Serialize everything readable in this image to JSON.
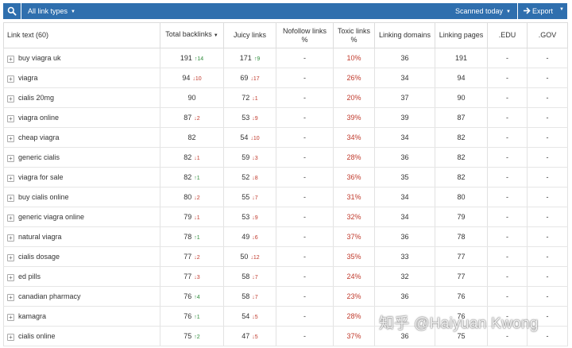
{
  "toolbar": {
    "search_icon": "search-icon",
    "link_types_label": "All link types",
    "scanned_label": "Scanned today",
    "export_label": "Export"
  },
  "columns": [
    "Link text (60)",
    "Total backlinks",
    "Juicy links",
    "Nofollow links %",
    "Toxic links %",
    "Linking domains",
    "Linking pages",
    ".EDU",
    ".GOV"
  ],
  "rows": [
    {
      "text": "buy viagra uk",
      "total": "191",
      "total_dir": "up",
      "total_delta": "14",
      "juicy": "171",
      "juicy_dir": "up",
      "juicy_delta": "9",
      "nofollow": "-",
      "toxic": "10%",
      "domains": "36",
      "pages": "191",
      "edu": "-",
      "gov": "-"
    },
    {
      "text": "viagra",
      "total": "94",
      "total_dir": "down",
      "total_delta": "10",
      "juicy": "69",
      "juicy_dir": "down",
      "juicy_delta": "17",
      "nofollow": "-",
      "toxic": "26%",
      "domains": "34",
      "pages": "94",
      "edu": "-",
      "gov": "-"
    },
    {
      "text": "cialis 20mg",
      "total": "90",
      "total_dir": "",
      "total_delta": "",
      "juicy": "72",
      "juicy_dir": "down",
      "juicy_delta": "1",
      "nofollow": "-",
      "toxic": "20%",
      "domains": "37",
      "pages": "90",
      "edu": "-",
      "gov": "-"
    },
    {
      "text": "viagra online",
      "total": "87",
      "total_dir": "down",
      "total_delta": "2",
      "juicy": "53",
      "juicy_dir": "down",
      "juicy_delta": "9",
      "nofollow": "-",
      "toxic": "39%",
      "domains": "39",
      "pages": "87",
      "edu": "-",
      "gov": "-"
    },
    {
      "text": "cheap viagra",
      "total": "82",
      "total_dir": "",
      "total_delta": "",
      "juicy": "54",
      "juicy_dir": "down",
      "juicy_delta": "10",
      "nofollow": "-",
      "toxic": "34%",
      "domains": "34",
      "pages": "82",
      "edu": "-",
      "gov": "-"
    },
    {
      "text": "generic cialis",
      "total": "82",
      "total_dir": "down",
      "total_delta": "1",
      "juicy": "59",
      "juicy_dir": "down",
      "juicy_delta": "3",
      "nofollow": "-",
      "toxic": "28%",
      "domains": "36",
      "pages": "82",
      "edu": "-",
      "gov": "-"
    },
    {
      "text": "viagra for sale",
      "total": "82",
      "total_dir": "up",
      "total_delta": "1",
      "juicy": "52",
      "juicy_dir": "down",
      "juicy_delta": "8",
      "nofollow": "-",
      "toxic": "36%",
      "domains": "35",
      "pages": "82",
      "edu": "-",
      "gov": "-"
    },
    {
      "text": "buy cialis online",
      "total": "80",
      "total_dir": "down",
      "total_delta": "2",
      "juicy": "55",
      "juicy_dir": "down",
      "juicy_delta": "7",
      "nofollow": "-",
      "toxic": "31%",
      "domains": "34",
      "pages": "80",
      "edu": "-",
      "gov": "-"
    },
    {
      "text": "generic viagra online",
      "total": "79",
      "total_dir": "down",
      "total_delta": "1",
      "juicy": "53",
      "juicy_dir": "down",
      "juicy_delta": "9",
      "nofollow": "-",
      "toxic": "32%",
      "domains": "34",
      "pages": "79",
      "edu": "-",
      "gov": "-"
    },
    {
      "text": "natural viagra",
      "total": "78",
      "total_dir": "up",
      "total_delta": "1",
      "juicy": "49",
      "juicy_dir": "down",
      "juicy_delta": "6",
      "nofollow": "-",
      "toxic": "37%",
      "domains": "36",
      "pages": "78",
      "edu": "-",
      "gov": "-"
    },
    {
      "text": "cialis dosage",
      "total": "77",
      "total_dir": "down",
      "total_delta": "2",
      "juicy": "50",
      "juicy_dir": "down",
      "juicy_delta": "12",
      "nofollow": "-",
      "toxic": "35%",
      "domains": "33",
      "pages": "77",
      "edu": "-",
      "gov": "-"
    },
    {
      "text": "ed pills",
      "total": "77",
      "total_dir": "down",
      "total_delta": "3",
      "juicy": "58",
      "juicy_dir": "down",
      "juicy_delta": "7",
      "nofollow": "-",
      "toxic": "24%",
      "domains": "32",
      "pages": "77",
      "edu": "-",
      "gov": "-"
    },
    {
      "text": "canadian pharmacy",
      "total": "76",
      "total_dir": "up",
      "total_delta": "4",
      "juicy": "58",
      "juicy_dir": "down",
      "juicy_delta": "7",
      "nofollow": "-",
      "toxic": "23%",
      "domains": "36",
      "pages": "76",
      "edu": "-",
      "gov": "-"
    },
    {
      "text": "kamagra",
      "total": "76",
      "total_dir": "up",
      "total_delta": "1",
      "juicy": "54",
      "juicy_dir": "down",
      "juicy_delta": "5",
      "nofollow": "-",
      "toxic": "28%",
      "domains": "",
      "pages": "76",
      "edu": "-",
      "gov": "-"
    },
    {
      "text": "cialis online",
      "total": "75",
      "total_dir": "up",
      "total_delta": "2",
      "juicy": "47",
      "juicy_dir": "down",
      "juicy_delta": "5",
      "nofollow": "-",
      "toxic": "37%",
      "domains": "36",
      "pages": "75",
      "edu": "-",
      "gov": "-"
    }
  ],
  "watermark": "知乎 @Haiyuan Kwong",
  "colors": {
    "toolbar": "#2f6fae",
    "up": "#2e8b3a",
    "down": "#c0392b",
    "toxic": "#c0392b"
  }
}
